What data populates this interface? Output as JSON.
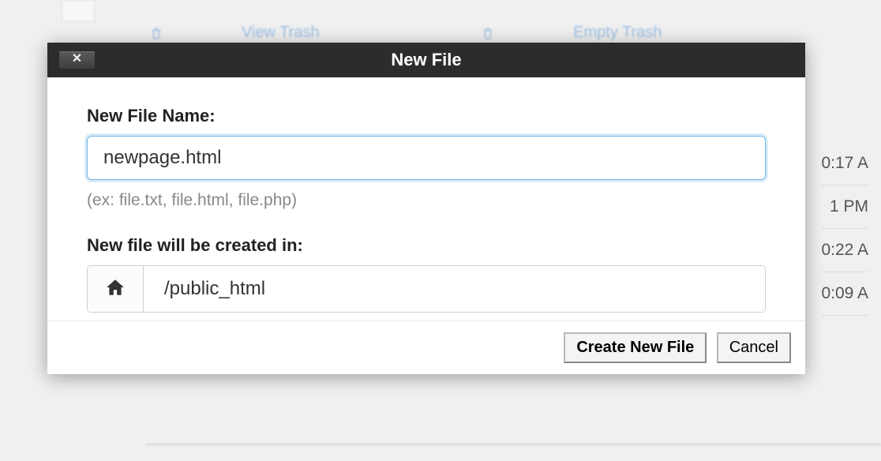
{
  "background": {
    "view_trash": "View Trash",
    "empty_trash": "Empty Trash",
    "times": [
      "0:17 A",
      "1 PM",
      "0:22 A",
      "0:09 A"
    ]
  },
  "modal": {
    "title": "New File",
    "close_label": "✕",
    "filename_label": "New File Name:",
    "filename_value": "newpage.html",
    "filename_hint": "(ex: file.txt, file.html, file.php)",
    "location_label": "New file will be created in:",
    "location_path": "/public_html",
    "create_button": "Create New File",
    "cancel_button": "Cancel"
  }
}
